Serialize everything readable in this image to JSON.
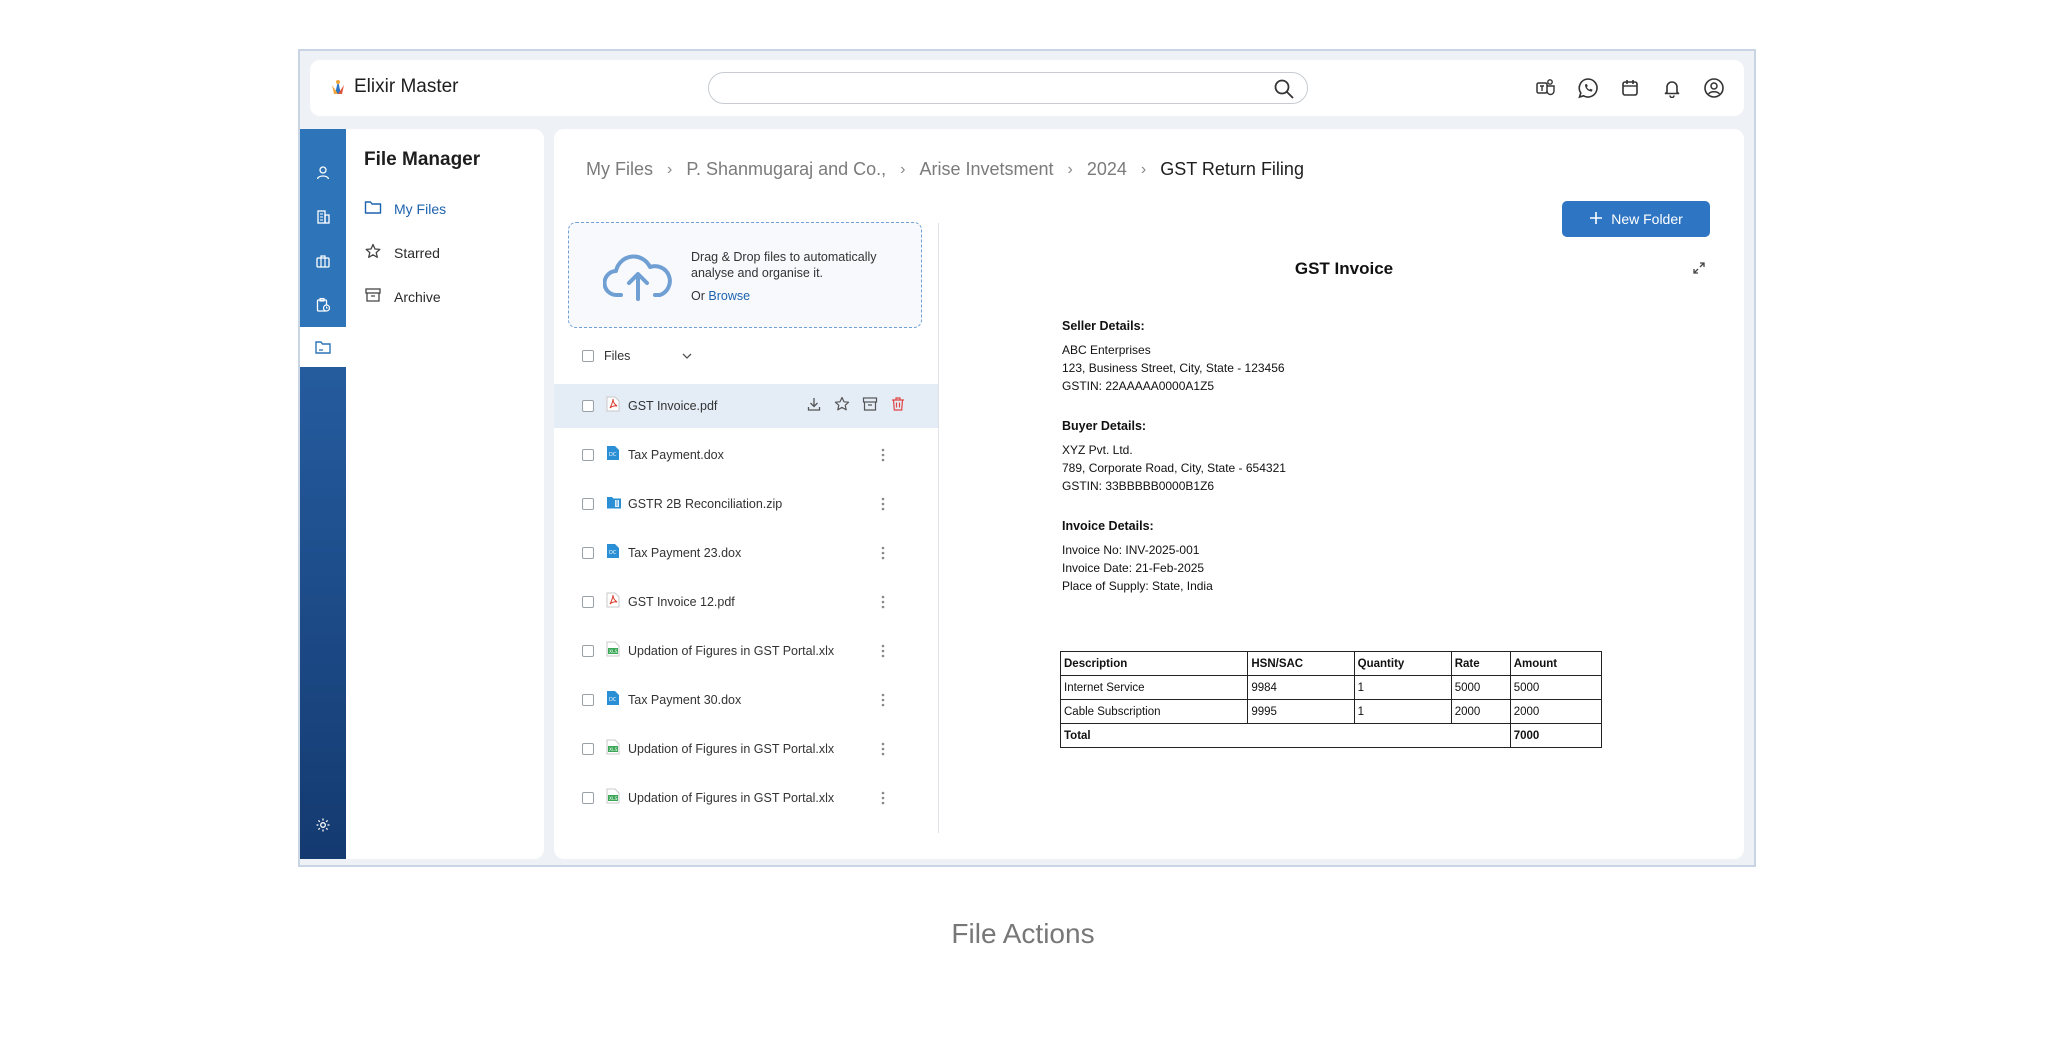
{
  "app": {
    "name": "Elixir Master"
  },
  "search": {
    "placeholder": ""
  },
  "sidebar": {
    "title": "File Manager",
    "items": [
      {
        "label": "My Files",
        "icon": "folder-icon",
        "active": true
      },
      {
        "label": "Starred",
        "icon": "star-icon",
        "active": false
      },
      {
        "label": "Archive",
        "icon": "archive-icon",
        "active": false
      }
    ]
  },
  "breadcrumb": [
    "My Files",
    "P. Shanmugaraj and Co.,",
    "Arise Invetsment",
    "2024",
    "GST Return Filing"
  ],
  "toolbar": {
    "new_folder_label": "New Folder"
  },
  "dropzone": {
    "text": "Drag & Drop files to automatically analyse and organise it.",
    "or": "Or",
    "browse": "Browse"
  },
  "files": {
    "header": "Files",
    "items": [
      {
        "name": "GST Invoice.pdf",
        "type": "pdf",
        "selected": true
      },
      {
        "name": "Tax Payment.dox",
        "type": "doc"
      },
      {
        "name": "GSTR 2B Reconciliation.zip",
        "type": "zip"
      },
      {
        "name": "Tax Payment 23.dox",
        "type": "doc"
      },
      {
        "name": "GST Invoice 12.pdf",
        "type": "pdf"
      },
      {
        "name": "Updation of Figures in GST Portal.xlx",
        "type": "xls"
      },
      {
        "name": "Tax Payment 30.dox",
        "type": "doc"
      },
      {
        "name": "Updation of Figures in GST Portal.xlx",
        "type": "xls"
      },
      {
        "name": "Updation of Figures in GST Portal.xlx",
        "type": "xls"
      }
    ]
  },
  "preview": {
    "title": "GST Invoice",
    "seller": {
      "head": "Seller Details:",
      "lines": [
        "ABC Enterprises",
        "123, Business Street, City, State - 123456",
        "GSTIN: 22AAAAA0000A1Z5"
      ]
    },
    "buyer": {
      "head": "Buyer Details:",
      "lines": [
        "XYZ Pvt. Ltd.",
        "789, Corporate Road, City, State - 654321",
        "GSTIN: 33BBBBB0000B1Z6"
      ]
    },
    "invoice": {
      "head": "Invoice Details:",
      "lines": [
        "Invoice No: INV-2025-001",
        "Invoice Date: 21-Feb-2025",
        "Place of Supply: State, India"
      ]
    },
    "table": {
      "headers": [
        "Description",
        "HSN/SAC",
        "Quantity",
        "Rate",
        "Amount"
      ],
      "rows": [
        [
          "Internet Service",
          "9984",
          "1",
          "5000",
          "5000"
        ],
        [
          "Cable Subscription",
          "9995",
          "1",
          "2000",
          "2000"
        ]
      ],
      "total_label": "Total",
      "total_value": "7000"
    }
  },
  "caption": "File Actions",
  "colors": {
    "accent": "#2e76c4",
    "rail": "#23589a",
    "selected_row": "#e4ecf6",
    "delete": "#e04444"
  }
}
